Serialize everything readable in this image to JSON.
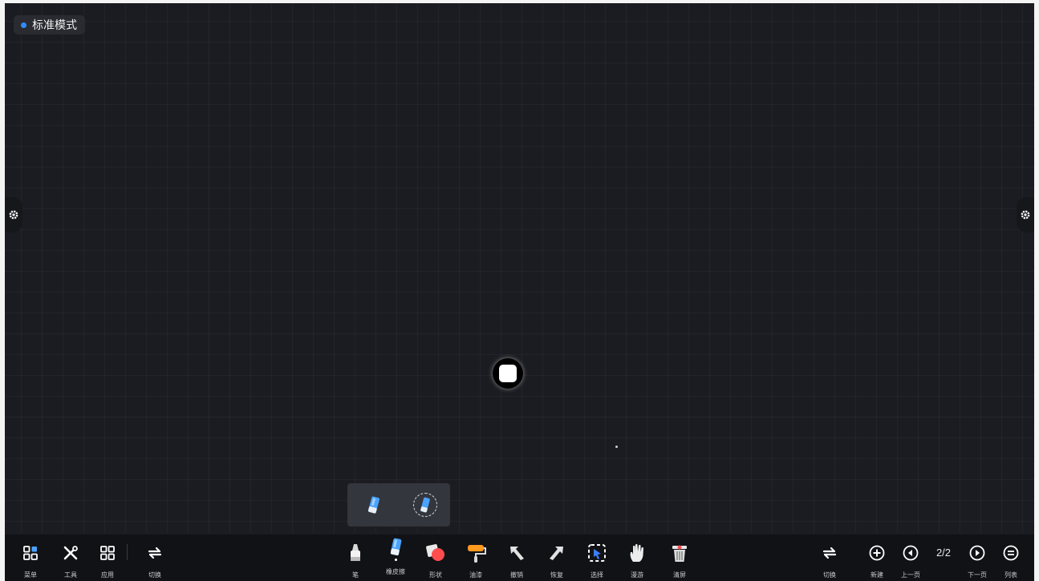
{
  "mode": {
    "label": "标准模式",
    "dot_color": "#2f8cff"
  },
  "left_toolbar": [
    {
      "id": "menu",
      "label": "菜单",
      "icon": "apps-grid-icon"
    },
    {
      "id": "tools",
      "label": "工具",
      "icon": "tools-icon"
    },
    {
      "id": "apps",
      "label": "应用",
      "icon": "app-grid-icon"
    },
    {
      "id": "switch",
      "label": "切换",
      "icon": "switch-icon"
    }
  ],
  "center_toolbar": [
    {
      "id": "pen",
      "label": "笔",
      "icon": "pen-icon"
    },
    {
      "id": "eraser",
      "label": "橡皮擦",
      "icon": "eraser-icon",
      "selected": true
    },
    {
      "id": "shape",
      "label": "形状",
      "icon": "shape-icon"
    },
    {
      "id": "paint",
      "label": "油漆",
      "icon": "paint-roller-icon"
    },
    {
      "id": "undo",
      "label": "撤销",
      "icon": "undo-arrow-icon"
    },
    {
      "id": "redo",
      "label": "恢复",
      "icon": "redo-arrow-icon"
    },
    {
      "id": "select",
      "label": "选择",
      "icon": "select-icon"
    },
    {
      "id": "roam",
      "label": "漫游",
      "icon": "hand-icon"
    },
    {
      "id": "clear",
      "label": "清屏",
      "icon": "trash-icon"
    }
  ],
  "right_toolbar": {
    "switch_label": "切换",
    "new_label": "新建",
    "prev_label": "上一页",
    "page_indicator": "2/2",
    "next_label": "下一页",
    "list_label": "列表"
  },
  "eraser_options": [
    {
      "id": "eraser-small",
      "icon": "eraser-small-icon"
    },
    {
      "id": "eraser-area",
      "icon": "eraser-area-icon"
    }
  ]
}
